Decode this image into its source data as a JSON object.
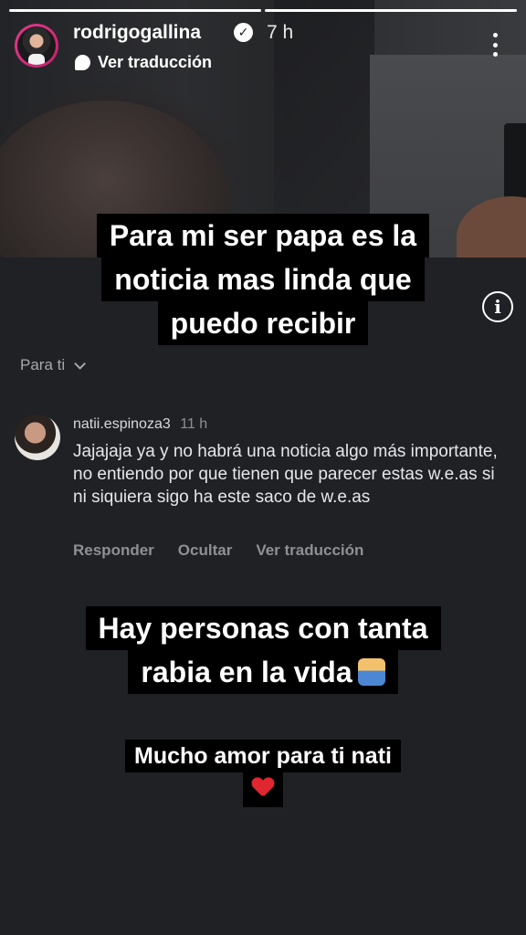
{
  "story": {
    "username": "rodrigogallina",
    "time": "7 h",
    "translate_label": "Ver traducción",
    "progress_segments": 2,
    "progress_active": 1
  },
  "captions": {
    "top": [
      "Para mi ser papa es la",
      "noticia mas linda que",
      "puedo recibir"
    ],
    "middle": [
      "Hay personas con tanta",
      "rabia en la vida"
    ],
    "bottom": [
      "Mucho amor para ti nati"
    ]
  },
  "comment_panel": {
    "filter_label": "Para ti",
    "comment": {
      "username": "natii.espinoza3",
      "time": "11 h",
      "text": "Jajajaja ya y no habrá una noticia algo más importante, no entiendo por que tienen que parecer estas w.e.as si ni siquiera sigo ha este saco de w.e.as",
      "actions": {
        "reply": "Responder",
        "hide": "Ocultar",
        "translate": "Ver traducción"
      }
    }
  },
  "icons": {
    "verified": "verified-badge-icon",
    "translate": "speech-bubble-icon",
    "more": "more-options-icon",
    "info": "info-icon",
    "chevron": "chevron-down-icon",
    "shrug_emoji": "person-shrugging-emoji",
    "heart_emoji": "red-heart-emoji"
  },
  "colors": {
    "background": "#1f2125",
    "caption_bg": "#000000",
    "avatar_ring": "#e03b8b",
    "muted_text": "#8e9094"
  }
}
